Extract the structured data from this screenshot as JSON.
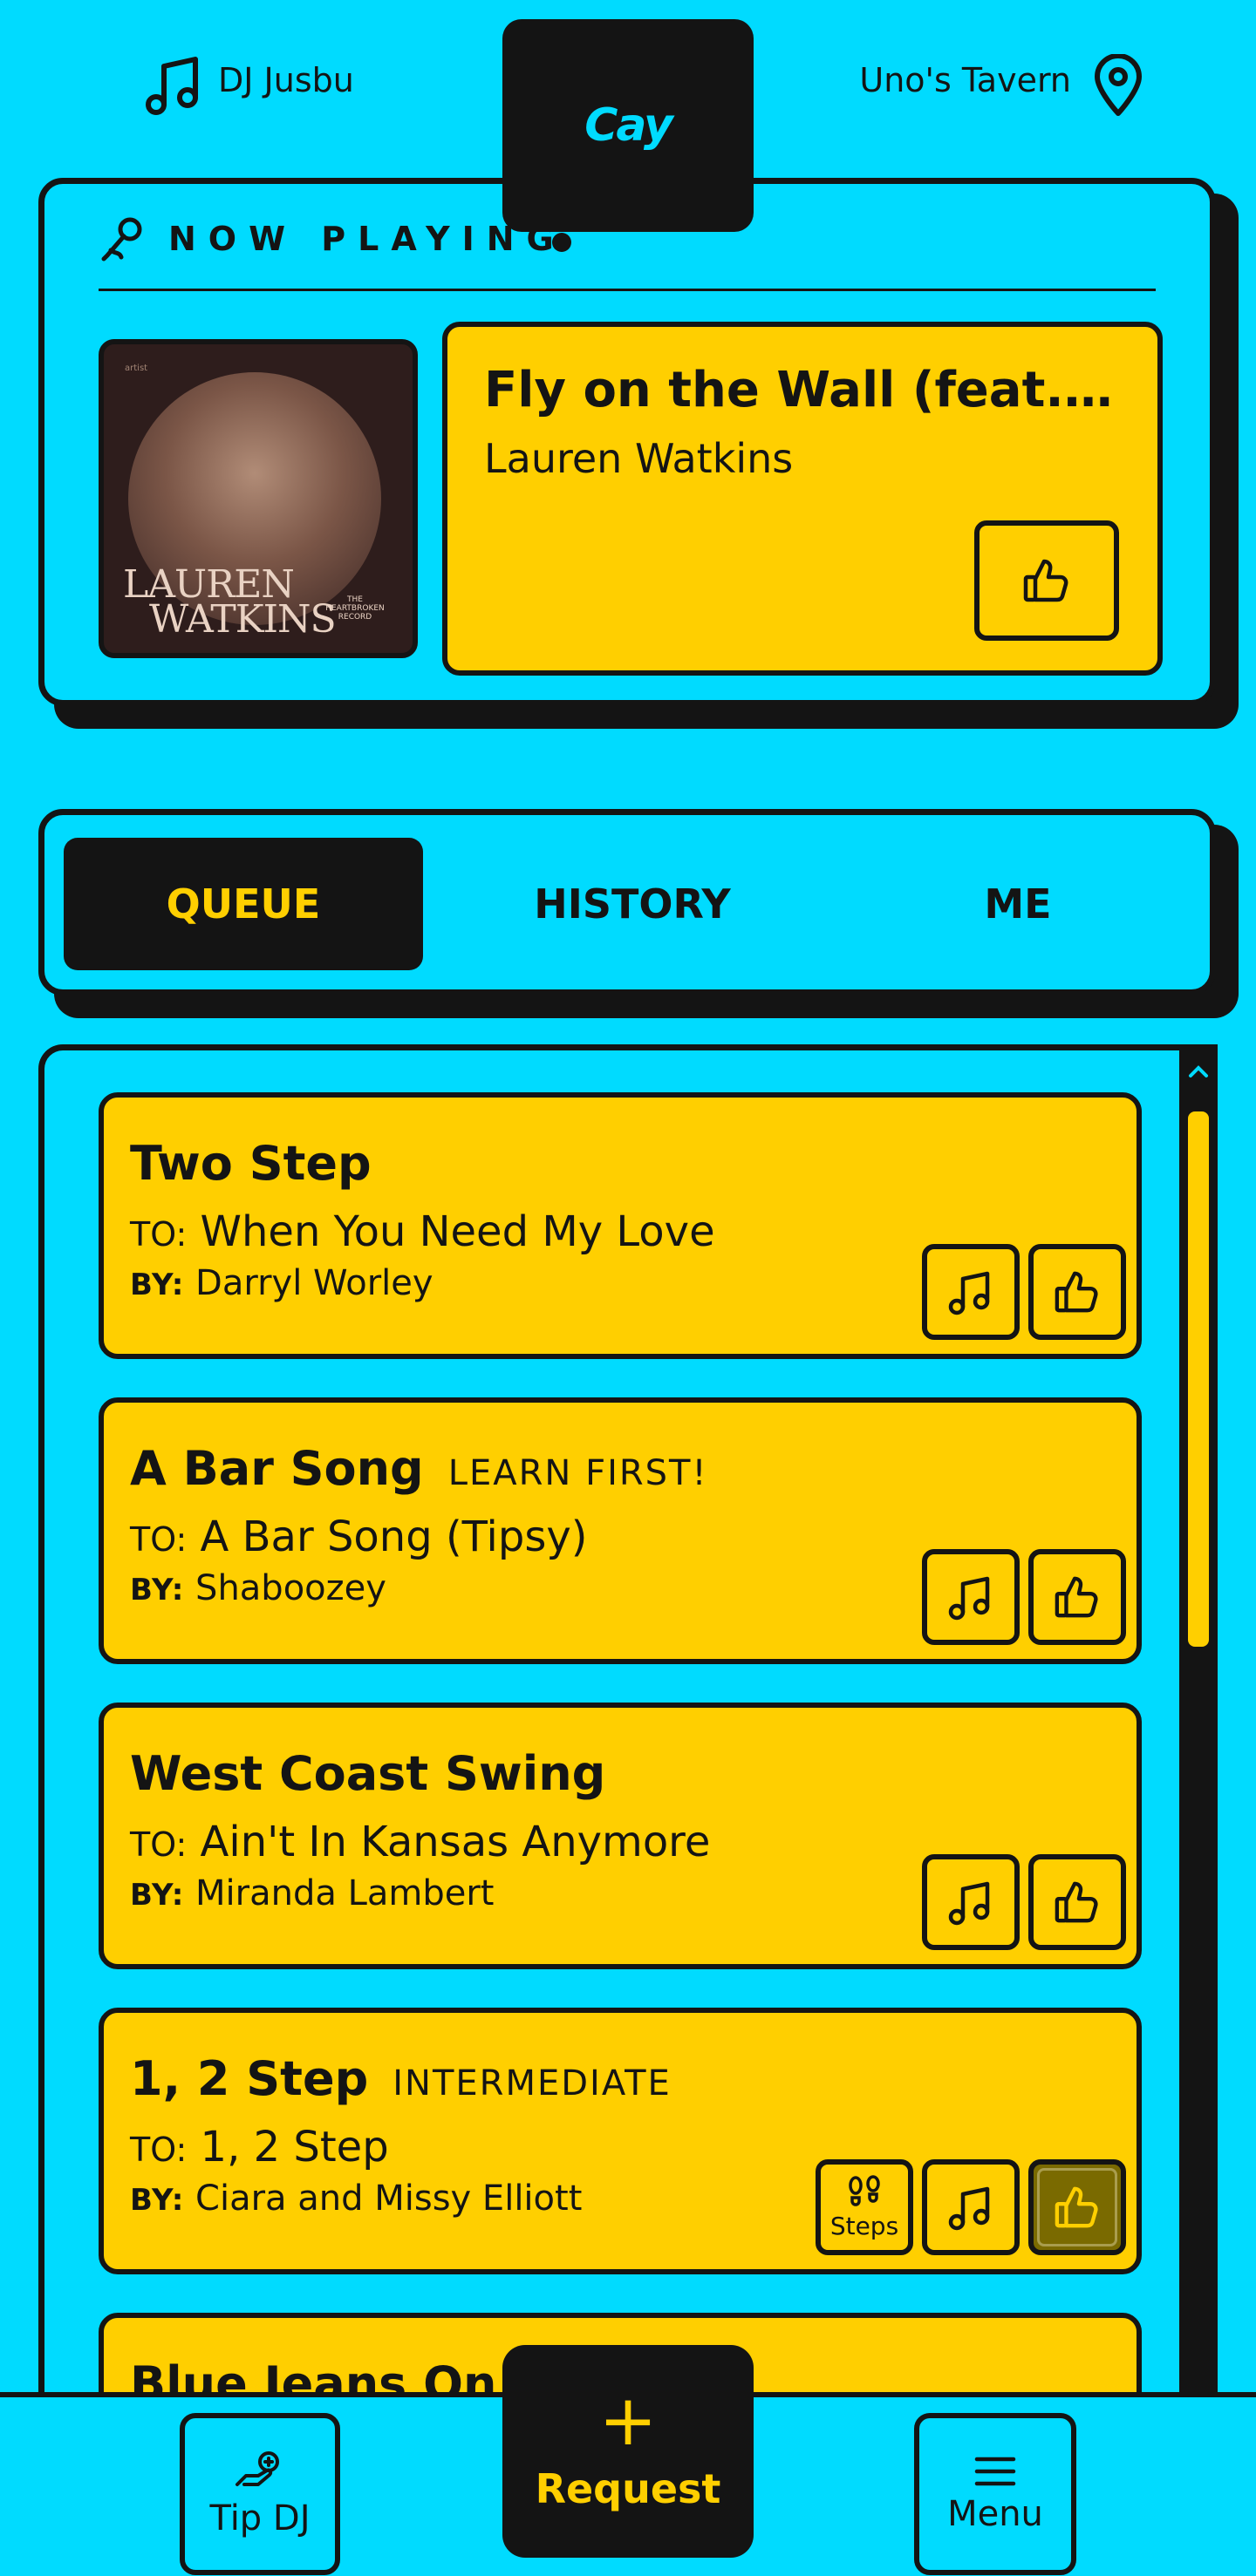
{
  "header": {
    "dj_name": "DJ Jusbu",
    "venue": "Uno's Tavern",
    "logo_text": "Cay"
  },
  "now_playing": {
    "label": "NOW PLAYING",
    "title": "Fly on the Wall (feat. J...",
    "artist": "Lauren Watkins",
    "album_art": {
      "label_small": "artist",
      "name_line1": "LAUREN",
      "name_line2": "WATKINS",
      "subtitle": "THE HEARTBROKEN RECORD"
    }
  },
  "tabs": [
    {
      "label": "QUEUE",
      "active": true
    },
    {
      "label": "HISTORY",
      "active": false
    },
    {
      "label": "ME",
      "active": false
    }
  ],
  "queue": {
    "to_label": "TO:",
    "by_label": "BY:",
    "items": [
      {
        "dance": "Two Step",
        "tag": "",
        "song": "When You Need My Love",
        "artist": "Darryl Worley",
        "steps": false,
        "liked": false
      },
      {
        "dance": "A Bar Song",
        "tag": "LEARN FIRST!",
        "song": "A Bar Song (Tipsy)",
        "artist": "Shaboozey",
        "steps": false,
        "liked": false
      },
      {
        "dance": "West Coast Swing",
        "tag": "",
        "song": "Ain't In Kansas Anymore",
        "artist": "Miranda Lambert",
        "steps": false,
        "liked": false
      },
      {
        "dance": "1, 2 Step",
        "tag": "INTERMEDIATE",
        "song": "1, 2 Step",
        "artist": "Ciara and Missy Elliott",
        "steps": true,
        "liked": true
      },
      {
        "dance": "Blue Jeans On",
        "tag": "",
        "song": "",
        "artist": "",
        "steps": false,
        "liked": false
      }
    ],
    "steps_label": "Steps"
  },
  "bottom_bar": {
    "tip_label": "Tip DJ",
    "request_label": "Request",
    "request_plus": "+",
    "menu_label": "Menu"
  },
  "colors": {
    "background": "#00DBFF",
    "accent": "#FFCF00",
    "ink": "#141414"
  }
}
